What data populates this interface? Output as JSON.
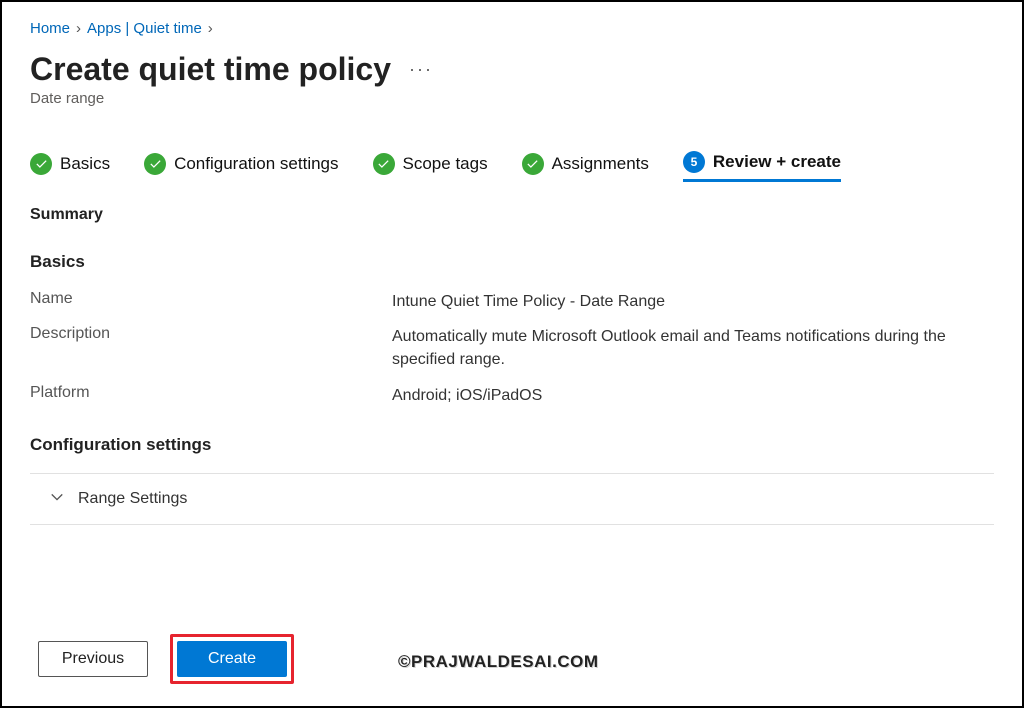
{
  "breadcrumb": {
    "home": "Home",
    "apps": "Apps | Quiet time"
  },
  "page": {
    "title": "Create quiet time policy",
    "subtitle": "Date range"
  },
  "tabs": {
    "basics": "Basics",
    "config": "Configuration settings",
    "scope": "Scope tags",
    "assign": "Assignments",
    "review_num": "5",
    "review": "Review + create"
  },
  "summary": {
    "heading": "Summary",
    "basics_heading": "Basics",
    "name_label": "Name",
    "name_value": "Intune Quiet Time Policy - Date Range",
    "desc_label": "Description",
    "desc_value": "Automatically mute Microsoft Outlook email and Teams notifications during the specified range.",
    "platform_label": "Platform",
    "platform_value": "Android; iOS/iPadOS",
    "config_heading": "Configuration settings",
    "range_settings": "Range Settings"
  },
  "buttons": {
    "previous": "Previous",
    "create": "Create"
  },
  "watermark": "©PRAJWALDESAI.COM"
}
